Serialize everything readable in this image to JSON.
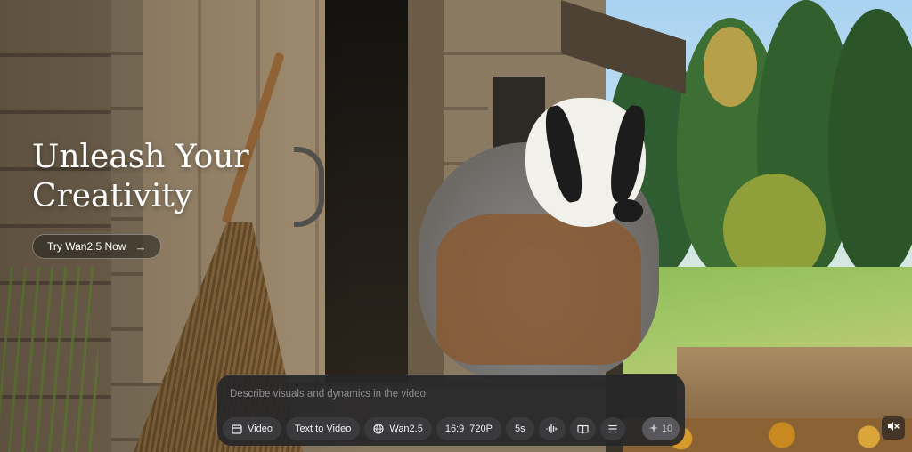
{
  "hero": {
    "title_line1": "Unleash Your",
    "title_line2": "Creativity",
    "cta_label": "Try Wan2.5 Now"
  },
  "composer": {
    "placeholder": "Describe visuals and dynamics in the video.",
    "value": "",
    "toolbar": {
      "mode_label": "Video",
      "task_label": "Text to Video",
      "model_label": "Wan2.5",
      "aspect_ratio": "16:9",
      "resolution": "720P",
      "duration": "5s"
    },
    "generate_cost": "10"
  },
  "icons": {
    "video": "video-icon",
    "model": "globe-icon",
    "audio": "waveform-icon",
    "book": "book-icon",
    "menu": "list-icon",
    "generate": "sparkle-icon",
    "cta": "arrow-right-icon",
    "mute": "speaker-muted-icon"
  }
}
